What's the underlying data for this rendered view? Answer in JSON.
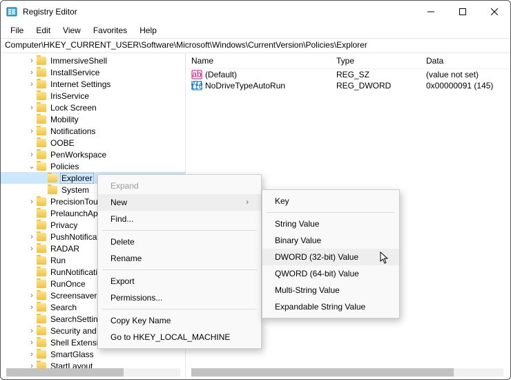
{
  "window": {
    "title": "Registry Editor"
  },
  "menubar": {
    "items": [
      "File",
      "Edit",
      "View",
      "Favorites",
      "Help"
    ]
  },
  "addressbar": {
    "path": "Computer\\HKEY_CURRENT_USER\\Software\\Microsoft\\Windows\\CurrentVersion\\Policies\\Explorer"
  },
  "tree": {
    "items": [
      {
        "label": "ImmersiveShell",
        "indent": 1,
        "expandable": true
      },
      {
        "label": "InstallService",
        "indent": 1,
        "expandable": true
      },
      {
        "label": "Internet Settings",
        "indent": 1,
        "expandable": true
      },
      {
        "label": "IrisService",
        "indent": 1,
        "expandable": false
      },
      {
        "label": "Lock Screen",
        "indent": 1,
        "expandable": true
      },
      {
        "label": "Mobility",
        "indent": 1,
        "expandable": false
      },
      {
        "label": "Notifications",
        "indent": 1,
        "expandable": true
      },
      {
        "label": "OOBE",
        "indent": 1,
        "expandable": false
      },
      {
        "label": "PenWorkspace",
        "indent": 1,
        "expandable": true
      },
      {
        "label": "Policies",
        "indent": 1,
        "expandable": true,
        "expanded": true
      },
      {
        "label": "Explorer",
        "indent": 2,
        "expandable": false,
        "selected": true
      },
      {
        "label": "System",
        "indent": 2,
        "expandable": false
      },
      {
        "label": "PrecisionTouch",
        "indent": 1,
        "expandable": true
      },
      {
        "label": "PrelaunchApps",
        "indent": 1,
        "expandable": false
      },
      {
        "label": "Privacy",
        "indent": 1,
        "expandable": false
      },
      {
        "label": "PushNotifications",
        "indent": 1,
        "expandable": true
      },
      {
        "label": "RADAR",
        "indent": 1,
        "expandable": true
      },
      {
        "label": "Run",
        "indent": 1,
        "expandable": false
      },
      {
        "label": "RunNotifications",
        "indent": 1,
        "expandable": false
      },
      {
        "label": "RunOnce",
        "indent": 1,
        "expandable": false
      },
      {
        "label": "Screensavers",
        "indent": 1,
        "expandable": true
      },
      {
        "label": "Search",
        "indent": 1,
        "expandable": true
      },
      {
        "label": "SearchSettings",
        "indent": 1,
        "expandable": false
      },
      {
        "label": "Security and Maintenance",
        "indent": 1,
        "expandable": true
      },
      {
        "label": "Shell Extensions",
        "indent": 1,
        "expandable": true
      },
      {
        "label": "SmartGlass",
        "indent": 1,
        "expandable": true
      },
      {
        "label": "StartLayout",
        "indent": 1,
        "expandable": true
      }
    ]
  },
  "values_header": {
    "name": "Name",
    "type": "Type",
    "data": "Data"
  },
  "values": [
    {
      "icon": "string",
      "name": "(Default)",
      "type": "REG_SZ",
      "data": "(value not set)"
    },
    {
      "icon": "binary",
      "name": "NoDriveTypeAutoRun",
      "type": "REG_DWORD",
      "data": "0x00000091 (145)"
    }
  ],
  "context_menu_1": {
    "items": [
      {
        "label": "Expand",
        "disabled": true
      },
      {
        "label": "New",
        "submenu": true,
        "hover": true
      },
      {
        "label": "Find..."
      },
      {
        "sep": true
      },
      {
        "label": "Delete"
      },
      {
        "label": "Rename"
      },
      {
        "sep": true
      },
      {
        "label": "Export"
      },
      {
        "label": "Permissions..."
      },
      {
        "sep": true
      },
      {
        "label": "Copy Key Name"
      },
      {
        "label": "Go to HKEY_LOCAL_MACHINE"
      }
    ]
  },
  "context_menu_2": {
    "items": [
      {
        "label": "Key"
      },
      {
        "sep": true
      },
      {
        "label": "String Value"
      },
      {
        "label": "Binary Value"
      },
      {
        "label": "DWORD (32-bit) Value",
        "hover": true
      },
      {
        "label": "QWORD (64-bit) Value"
      },
      {
        "label": "Multi-String Value"
      },
      {
        "label": "Expandable String Value"
      }
    ]
  }
}
